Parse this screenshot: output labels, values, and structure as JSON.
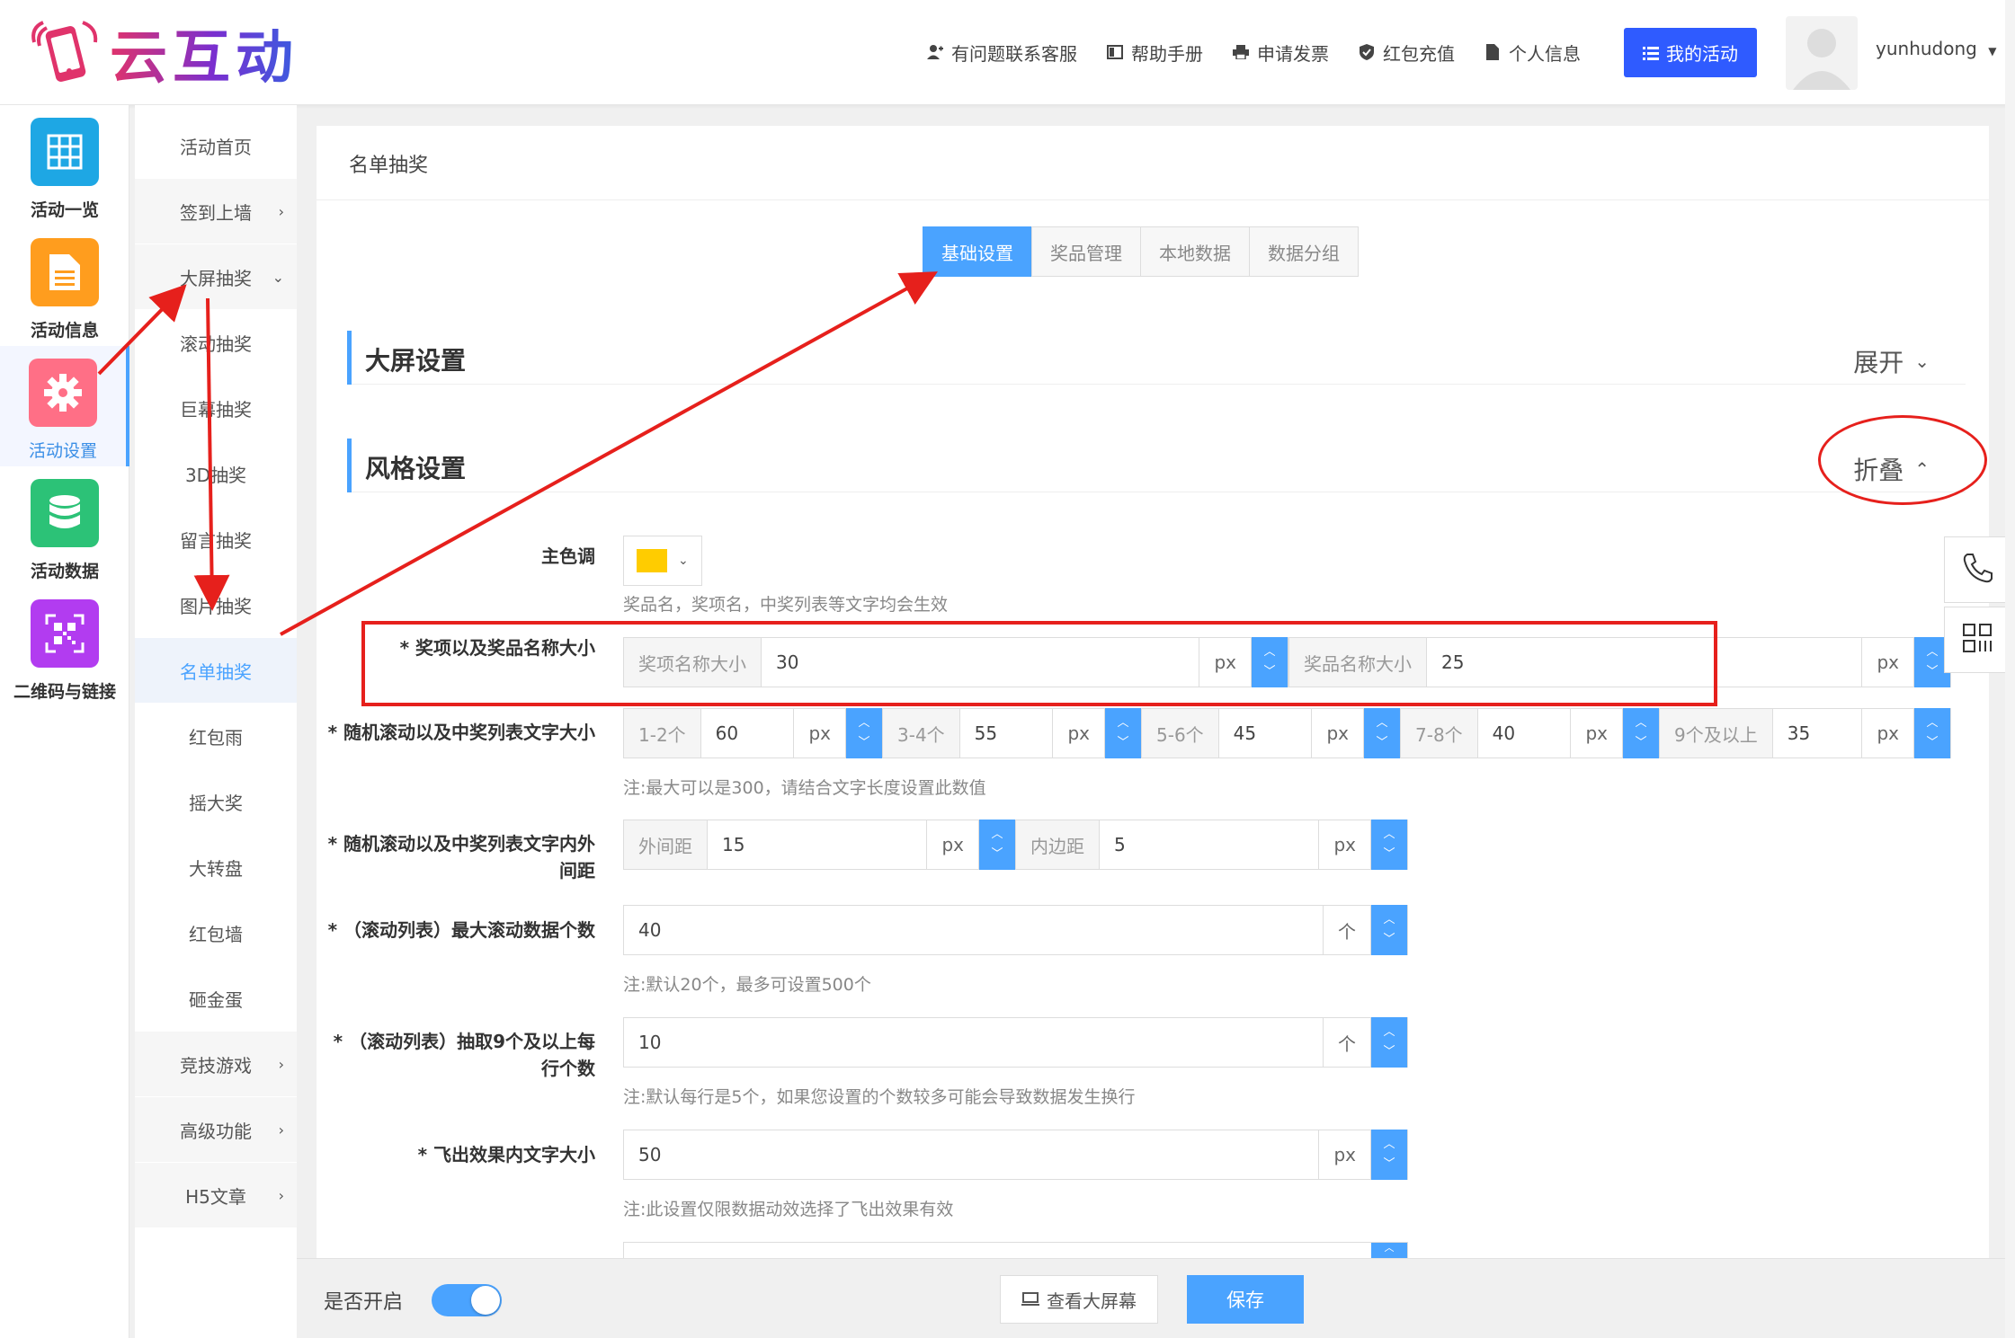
{
  "brand": {
    "logo_text": "云互动"
  },
  "header": {
    "links": [
      {
        "label": "有问题联系客服",
        "icon": "user-add-icon"
      },
      {
        "label": "帮助手册",
        "icon": "book-icon"
      },
      {
        "label": "申请发票",
        "icon": "printer-icon"
      },
      {
        "label": "红包充值",
        "icon": "shield-check-icon"
      },
      {
        "label": "个人信息",
        "icon": "document-icon"
      }
    ],
    "my_activity": "我的活动",
    "username": "yunhudong"
  },
  "iconbar": {
    "items": [
      {
        "label": "活动一览",
        "color": "#1ea7e4",
        "icon": "grid-icon"
      },
      {
        "label": "活动信息",
        "color": "#ff9d1e",
        "icon": "document-icon"
      },
      {
        "label": "活动设置",
        "color": "#ff6f86",
        "icon": "gear-icon",
        "active": true
      },
      {
        "label": "活动数据",
        "color": "#2cc277",
        "icon": "database-icon"
      },
      {
        "label": "二维码与链接",
        "color": "#b23cf0",
        "icon": "qrcode-icon"
      }
    ]
  },
  "subnav": {
    "items": [
      "活动首页",
      "签到上墙",
      "大屏抽奖",
      "滚动抽奖",
      "巨幕抽奖",
      "3D抽奖",
      "留言抽奖",
      "图片抽奖",
      "名单抽奖",
      "红包雨",
      "摇大奖",
      "大转盘",
      "红包墙",
      "砸金蛋",
      "竞技游戏",
      "高级功能",
      "H5文章"
    ]
  },
  "main": {
    "title": "名单抽奖",
    "tabs": [
      "基础设置",
      "奖品管理",
      "本地数据",
      "数据分组"
    ],
    "sections": {
      "screen": {
        "title": "大屏设置",
        "toggle": "展开"
      },
      "style": {
        "title": "风格设置",
        "toggle": "折叠"
      }
    },
    "fields": {
      "main_color": {
        "label": "主色调",
        "hint": "奖品名，奖项名，中奖列表等文字均会生效"
      },
      "name_size": {
        "label": "* 奖项以及奖品名称大小",
        "a_label": "奖项名称大小",
        "a_value": "30",
        "b_label": "奖品名称大小",
        "b_value": "25",
        "unit": "px"
      },
      "list_text_size": {
        "label": "* 随机滚动以及中奖列表文字大小",
        "groups": [
          {
            "label": "1-2个",
            "value": "60"
          },
          {
            "label": "3-4个",
            "value": "55"
          },
          {
            "label": "5-6个",
            "value": "45"
          },
          {
            "label": "7-8个",
            "value": "40"
          },
          {
            "label": "9个及以上",
            "value": "35"
          }
        ],
        "unit": "px",
        "hint": "注:最大可以是300，请结合文字长度设置此数值"
      },
      "padding": {
        "label": "* 随机滚动以及中奖列表文字内外间距",
        "outer_label": "外间距",
        "outer_value": "15",
        "inner_label": "内边距",
        "inner_value": "5",
        "unit": "px"
      },
      "max_scroll": {
        "label": "* （滚动列表）最大滚动数据个数",
        "value": "40",
        "unit": "个",
        "hint": "注:默认20个，最多可设置500个"
      },
      "per_row": {
        "label": "* （滚动列表）抽取9个及以上每行个数",
        "value": "10",
        "unit": "个",
        "hint": "注:默认每行是5个，如果您设置的个数较多可能会导致数据发生换行"
      },
      "fly_size": {
        "label": "* 飞出效果内文字大小",
        "value": "50",
        "unit": "px",
        "hint": "注:此设置仅限数据动效选择了飞出效果有效"
      }
    }
  },
  "bottom": {
    "enable_label": "是否开启",
    "view_label": "查看大屏幕",
    "save_label": "保存"
  }
}
